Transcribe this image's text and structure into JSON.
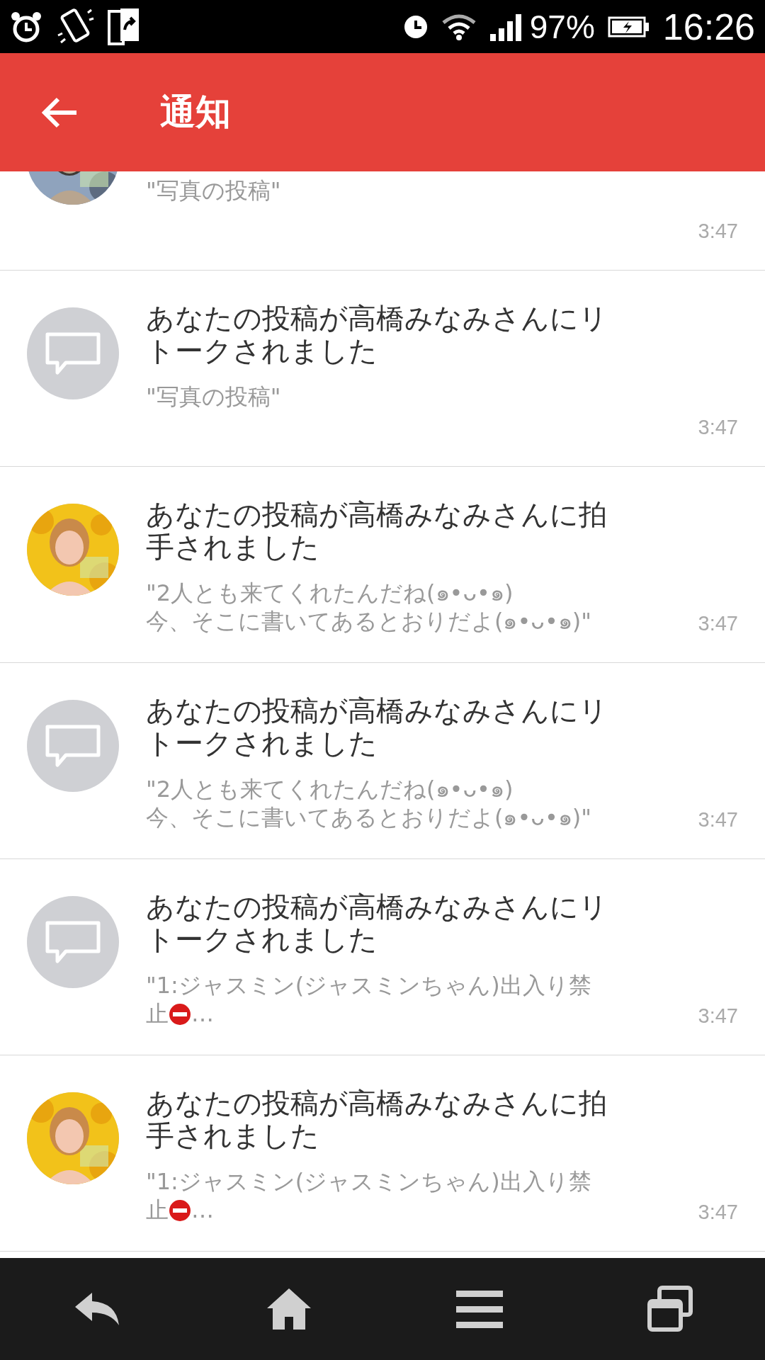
{
  "status_bar": {
    "battery": "97%",
    "time": "16:26"
  },
  "app_bar": {
    "title": "通知"
  },
  "notifications": [
    {
      "partial": true,
      "quote": "\"写真の投稿\"",
      "time": "3:47"
    },
    {
      "partial": false,
      "kind": "default",
      "title": "あなたの投稿が高橋みなみさんにリトークされました",
      "quote": "\"写真の投稿\"",
      "time": "3:47"
    },
    {
      "partial": false,
      "title": "あなたの投稿が高橋みなみさんに拍手されました",
      "quote": "\"2人とも来てくれたんだね(๑•ᴗ•๑)\n今、そこに書いてあるとおりだよ(๑•ᴗ•๑)\"",
      "time": "3:47"
    },
    {
      "partial": false,
      "kind": "default",
      "title": "あなたの投稿が高橋みなみさんにリトークされました",
      "quote": "\"2人とも来てくれたんだね(๑•ᴗ•๑)\n今、そこに書いてあるとおりだよ(๑•ᴗ•๑)\"",
      "time": "3:47"
    },
    {
      "partial": false,
      "kind": "default",
      "title": "あなたの投稿が高橋みなみさんにリトークされました",
      "quote": "\"1:ジャスミン(ジャスミンちゃん)出入り禁止",
      "no_entry": true,
      "ellipsis": "…",
      "time": "3:47"
    },
    {
      "partial": false,
      "title": "あなたの投稿が高橋みなみさんに拍手されました",
      "quote": "\"1:ジャスミン(ジャスミンちゃん)出入り禁止",
      "no_entry": true,
      "ellipsis": "…",
      "time": "3:47"
    }
  ]
}
